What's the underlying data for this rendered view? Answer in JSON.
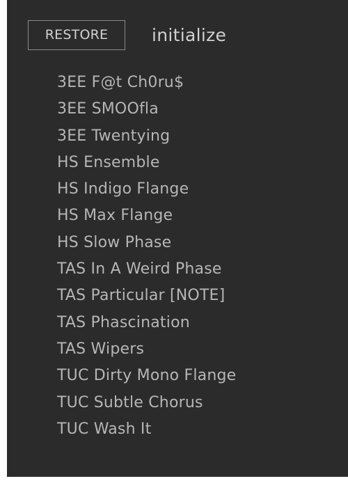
{
  "toolbar": {
    "restore_label": "RESTORE",
    "current_preset": "initialize"
  },
  "presets": [
    "3EE F@t Ch0ru$",
    "3EE SMOOfla",
    "3EE Twentying",
    "HS Ensemble",
    "HS Indigo Flange",
    "HS Max Flange",
    "HS Slow Phase",
    "TAS In A Weird Phase",
    "TAS Particular [NOTE]",
    "TAS Phascination",
    "TAS Wipers",
    "TUC Dirty Mono Flange",
    "TUC Subtle Chorus",
    "TUC Wash It"
  ],
  "colors": {
    "panel_background": "#2b2b2b",
    "item_text": "#b6b6b6",
    "button_border": "#8a8a8a"
  }
}
